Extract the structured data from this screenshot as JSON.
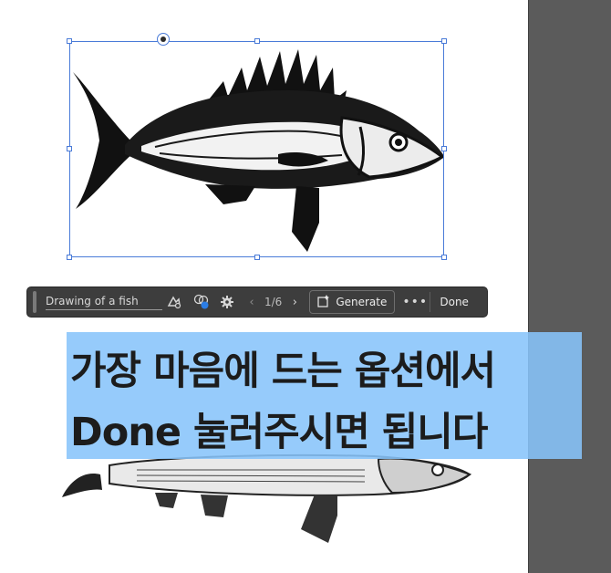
{
  "artboard": {
    "image_top_description": "ink drawing of a fish, selected",
    "image_bottom_description": "ink drawing of a fish"
  },
  "toolbar": {
    "prompt_text": "Drawing of a fish",
    "page_indicator": "1/6",
    "generate_label": "Generate",
    "more_label": "•••",
    "done_label": "Done",
    "icons": [
      "grip-handle-icon",
      "style-reference-icon",
      "color-variants-icon",
      "settings-gear-icon",
      "chevron-left-icon",
      "chevron-right-icon",
      "generate-sparkle-icon",
      "more-icon"
    ]
  },
  "caption": {
    "line1": "가장 마음에 드는 옵션에서",
    "line2": "Done 눌러주시면 됩니다"
  },
  "colors": {
    "selection": "#4a7bd8",
    "toolbar_bg": "#3d3d3d",
    "caption_bg": "#88c4fa",
    "pasteboard": "#5b5b5b"
  }
}
